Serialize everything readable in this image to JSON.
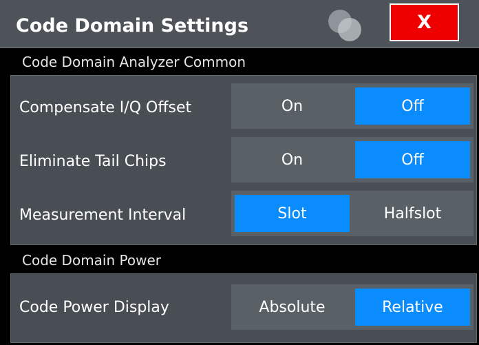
{
  "dialog": {
    "title": "Code Domain Settings",
    "close_label": "X"
  },
  "colors": {
    "titlebar_bg": "#4d5358",
    "close_bg": "#ee0000",
    "panel_bg": "#484e53",
    "toggle_bg": "#5a6166",
    "active_option": "#0a8cff"
  },
  "sections": [
    {
      "header": "Code Domain Analyzer Common",
      "rows": [
        {
          "label": "Compensate I/Q Offset",
          "options": [
            "On",
            "Off"
          ],
          "selected": "Off"
        },
        {
          "label": "Eliminate Tail Chips",
          "options": [
            "On",
            "Off"
          ],
          "selected": "Off"
        },
        {
          "label": "Measurement Interval",
          "options": [
            "Slot",
            "Halfslot"
          ],
          "selected": "Slot"
        }
      ]
    },
    {
      "header": "Code Domain Power",
      "rows": [
        {
          "label": "Code Power Display",
          "options": [
            "Absolute",
            "Relative"
          ],
          "selected": "Relative"
        }
      ]
    }
  ]
}
